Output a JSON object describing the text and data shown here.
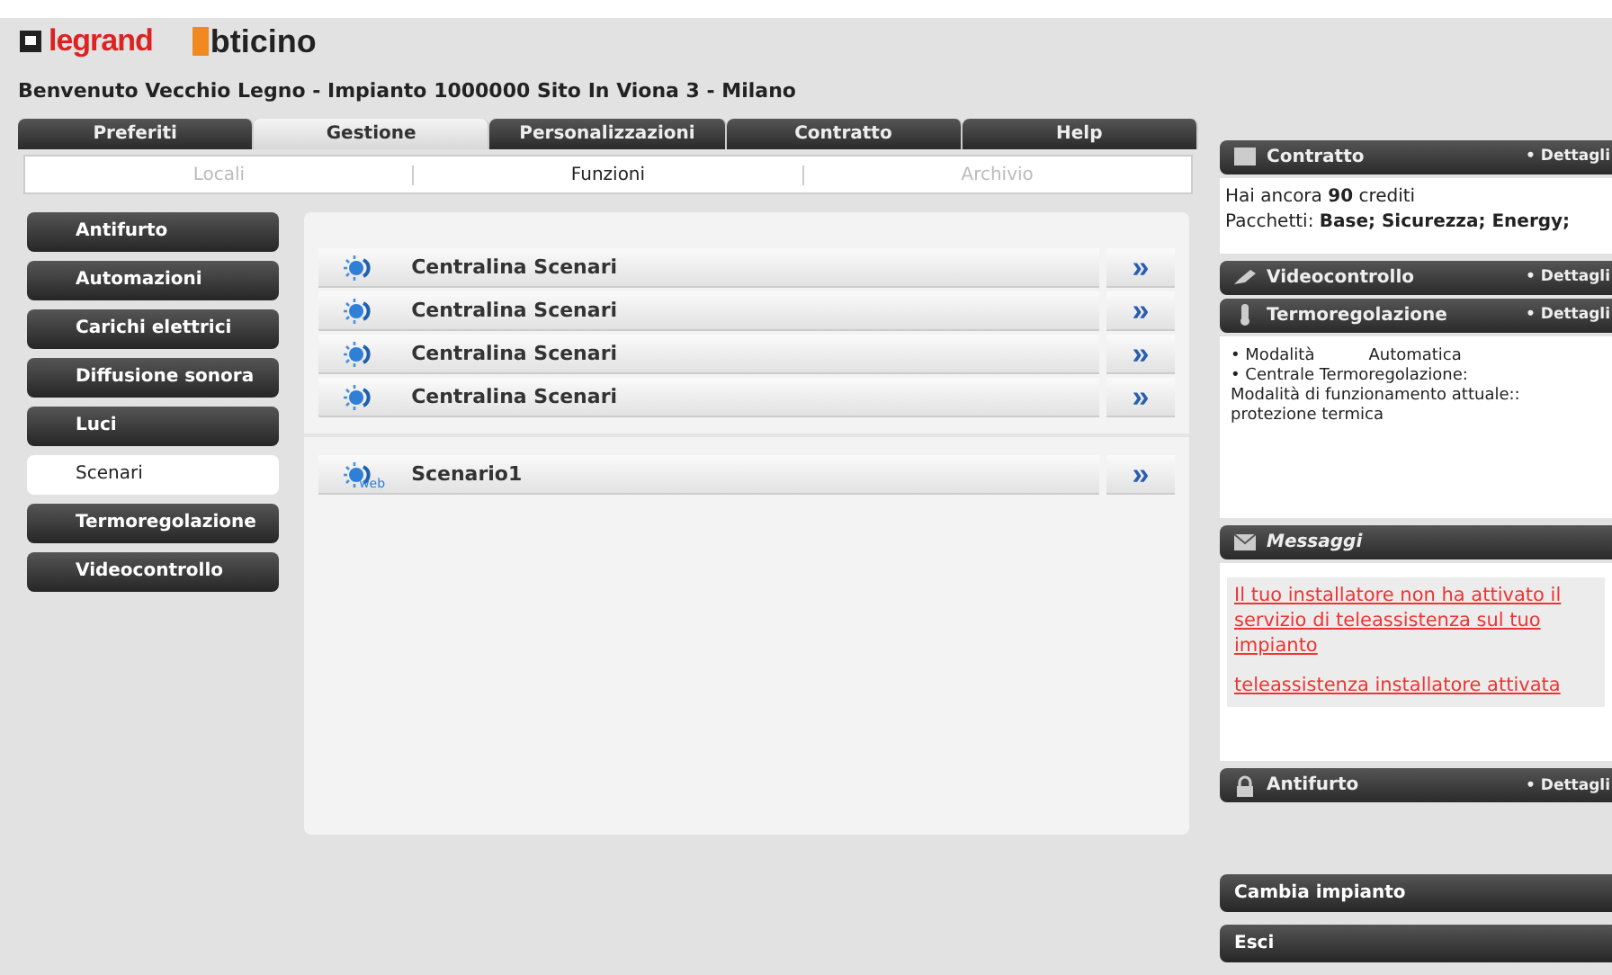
{
  "header": {
    "logos": [
      "legrand",
      "bticino"
    ],
    "welcome": "Benvenuto Vecchio Legno - Impianto 1000000 Sito In Viona 3 - Milano"
  },
  "tabs": [
    {
      "label": "Preferiti",
      "selected": false
    },
    {
      "label": "Gestione",
      "selected": true
    },
    {
      "label": "Personalizzazioni",
      "selected": false
    },
    {
      "label": "Contratto",
      "selected": false
    },
    {
      "label": "Help",
      "selected": false
    }
  ],
  "subtabs": [
    {
      "label": "Locali",
      "selected": false
    },
    {
      "label": "Funzioni",
      "selected": true
    },
    {
      "label": "Archivio",
      "selected": false
    }
  ],
  "sidebar": {
    "items": [
      {
        "label": "Antifurto",
        "selected": false
      },
      {
        "label": "Automazioni",
        "selected": false
      },
      {
        "label": "Carichi elettrici",
        "selected": false
      },
      {
        "label": "Diffusione sonora",
        "selected": false
      },
      {
        "label": "Luci",
        "selected": false
      },
      {
        "label": "Scenari",
        "selected": true
      },
      {
        "label": "Termoregolazione",
        "selected": false
      },
      {
        "label": "Videocontrollo",
        "selected": false
      }
    ]
  },
  "scenario_groups": [
    [
      {
        "label": "Centralina Scenari",
        "kind": "centralina",
        "action": "»"
      },
      {
        "label": "Centralina Scenari",
        "kind": "centralina",
        "action": "»"
      },
      {
        "label": "Centralina Scenari",
        "kind": "centralina",
        "action": "»"
      },
      {
        "label": "Centralina Scenari",
        "kind": "centralina",
        "action": "»"
      }
    ],
    [
      {
        "label": "Scenario1",
        "kind": "web",
        "action": "»",
        "badge": "web"
      }
    ]
  ],
  "right_panel": {
    "contratto": {
      "title": "Contratto",
      "link": "• Dettagli",
      "credits": "Hai ancora **90** crediti",
      "packages": "Pacchetti: **Base; Sicurezza; Energy;**"
    },
    "videocontrollo": {
      "title": "Videocontrollo",
      "link": "• Dettagli"
    },
    "termoregolazione": {
      "title": "Termoregolazione",
      "link": "• Dettagli",
      "mode_label": "• Modalità",
      "mode_value": "Automatica",
      "lines": [
        "• Centrale Termoregolazione:",
        "Modalità di funzionamento attuale::",
        "protezione termica"
      ]
    },
    "messaggi": {
      "title": "Messaggi",
      "messages": [
        "Il tuo installatore non ha attivato il servizio di teleassistenza sul tuo impianto",
        "teleassistenza installatore attivata"
      ]
    },
    "antifurto": {
      "title": "Antifurto",
      "link": "• Dettagli"
    },
    "buttons": [
      "Cambia impianto",
      "Esci"
    ]
  }
}
